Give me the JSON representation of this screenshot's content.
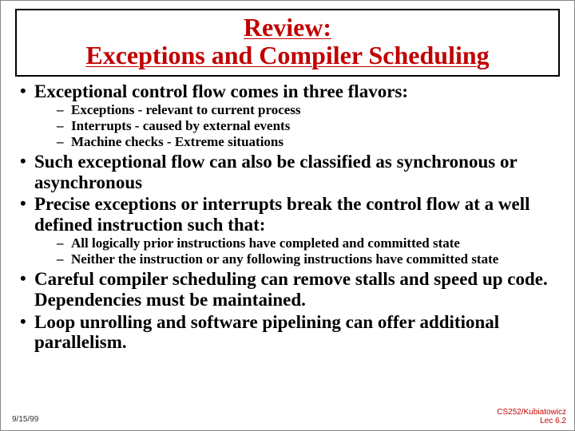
{
  "title_line1": "Review:",
  "title_line2": "Exceptions and Compiler Scheduling",
  "bullets": [
    {
      "text": "Exceptional control flow comes in three flavors:",
      "sub": [
        "Exceptions - relevant to current process",
        "Interrupts - caused by external events",
        "Machine checks - Extreme situations"
      ]
    },
    {
      "text": "Such exceptional flow can also be classified as synchronous or asynchronous",
      "sub": []
    },
    {
      "text": "Precise exceptions or interrupts break the control flow at a well defined instruction such that:",
      "sub": [
        "All logically prior instructions have completed and committed state",
        "Neither the instruction or any following instructions have committed state"
      ]
    },
    {
      "text": "Careful compiler scheduling can remove stalls and speed up code.   Dependencies must be maintained.",
      "sub": []
    },
    {
      "text": "Loop unrolling and software pipelining can offer additional parallelism.",
      "sub": []
    }
  ],
  "footer": {
    "date": "9/15/99",
    "course": "CS252/Kubiatowicz",
    "lecture": "Lec 6.2"
  }
}
